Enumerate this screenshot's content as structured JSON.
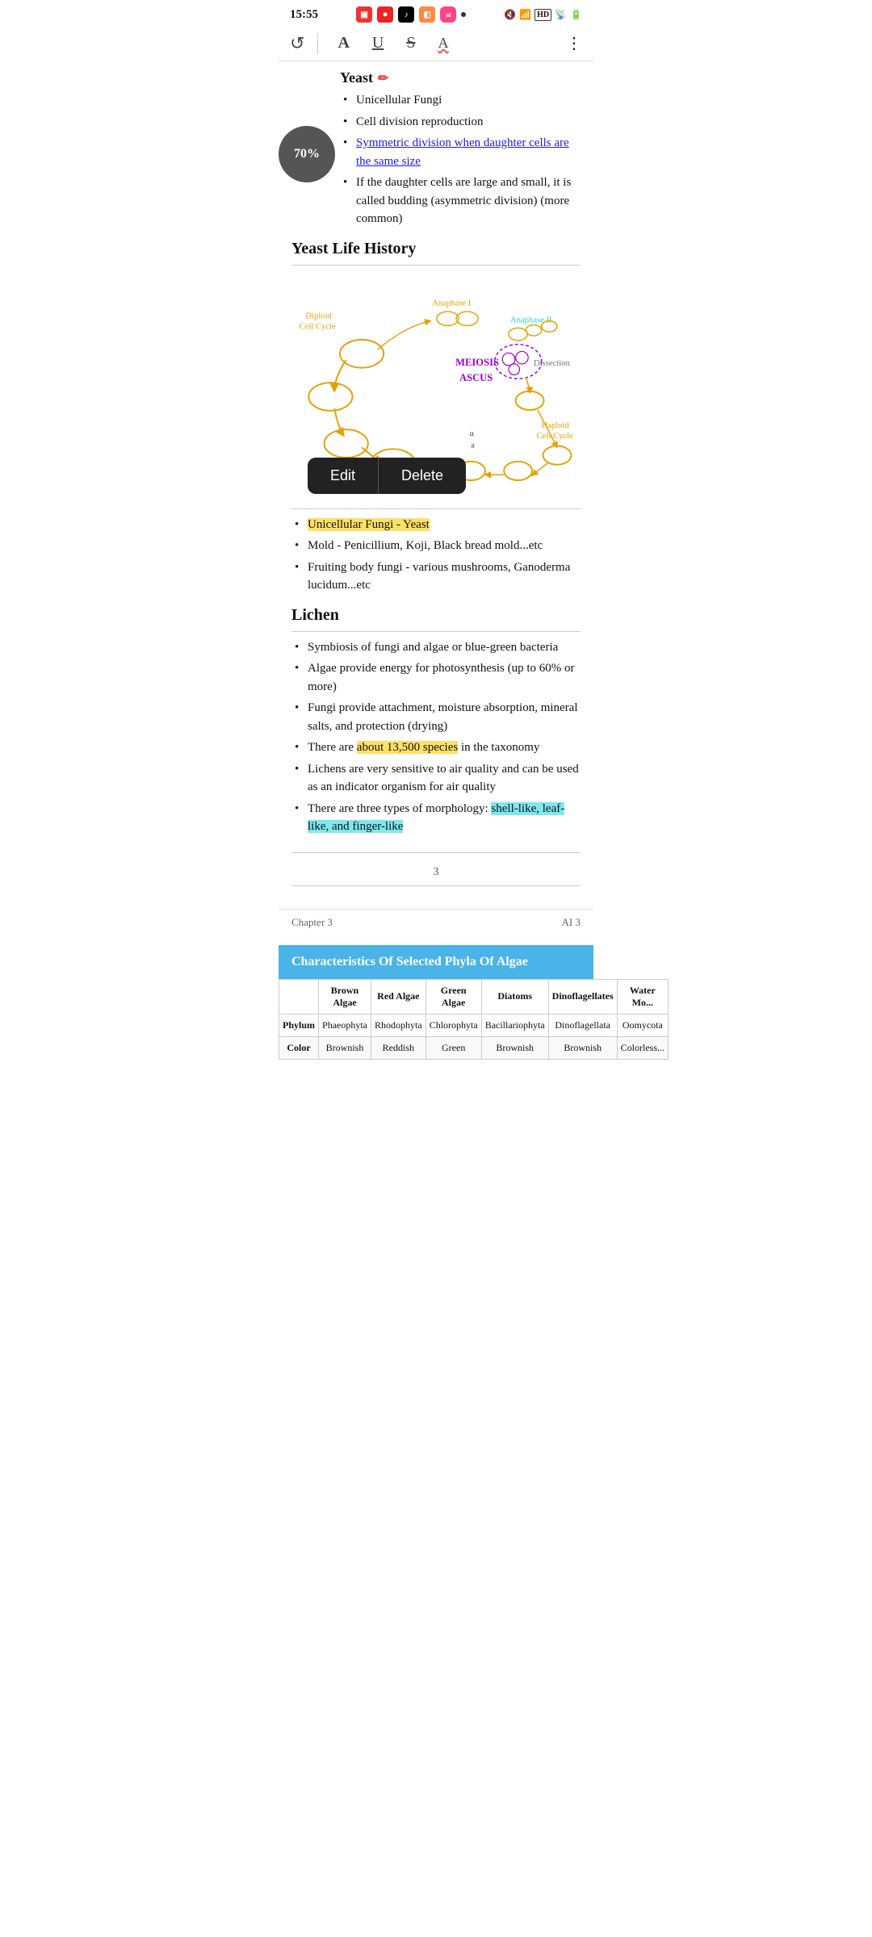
{
  "statusBar": {
    "time": "15:55",
    "dot": "●",
    "batteryIcon": "🔋"
  },
  "toolbar": {
    "undoSymbol": "↺",
    "boldLabel": "A",
    "underlineLabel": "U",
    "strikeLabel": "S",
    "waveLabel": "A",
    "moreLabel": "⋮"
  },
  "progress": {
    "value": "70%"
  },
  "content": {
    "yeastTitle": "Yeast",
    "bullets": [
      "Unicellular Fungi",
      "Cell division reproduction",
      "Symmetric division when daughter cells are the same size",
      "If the daughter cells are large and small, it is called budding (asymmetric division) (more common)"
    ],
    "yeastLifeHistoryHeading": "Yeast Life History",
    "diagramLabels": {
      "diploid": "Diploid",
      "cellCycle": "Cell Cycle",
      "anaphase1": "Anaphase I",
      "anaphase2": "Anaphase II",
      "meiosis": "MEIOSIS",
      "ascus": "ASCUS",
      "dissection": "Dissection",
      "haploid": "Haploid",
      "haploidCycle": "Cell Cycle",
      "alphaSymbol": "α",
      "aSymbol": "a"
    },
    "editLabel": "Edit",
    "deleteLabel": "Delete",
    "bullets2": [
      {
        "text": "Unicellular Fungi - Yeast",
        "highlight": "yellow"
      },
      {
        "text": "Mold - Penicillium, Koji, Black bread mold...etc",
        "highlight": "none"
      },
      {
        "text": "Fruiting body fungi - various mushrooms, Ganoderma lucidum...etc",
        "highlight": "none"
      }
    ],
    "lichenHeading": "Lichen",
    "lichenBullets": [
      {
        "text": "Symbiosis of fungi and algae or blue-green bacteria",
        "highlight": "none"
      },
      {
        "text": "Algae provide energy for photosynthesis (up to 60% or more)",
        "highlight": "none"
      },
      {
        "text": "Fungi provide attachment, moisture absorption, mineral salts, and protection (drying)",
        "highlight": "none"
      },
      {
        "text": "There are ",
        "highlight_part": "about 13,500 species",
        "text_after": " in the taxonomy",
        "highlight": "yellow"
      },
      {
        "text": "Lichens are very sensitive to air quality and can be used as an indicator organism for air quality",
        "highlight": "none"
      },
      {
        "text": "There are three types of morphology: ",
        "highlight_part": "shell-like, leaf-like, and finger-like",
        "text_after": "",
        "highlight": "cyan"
      }
    ],
    "pageNumber": "3"
  },
  "chapterFooter": {
    "left": "Chapter 3",
    "right": "AI 3"
  },
  "algaeTable": {
    "title": "Characteristics Of Selected Phyla Of Algae",
    "columns": [
      "Brown Algae",
      "Red Algae",
      "Green Algae",
      "Diatoms",
      "Dinoflagellates",
      "Water Mo..."
    ],
    "rows": [
      {
        "label": "Phylum",
        "values": [
          "Phaeophyta",
          "Rhodophyta",
          "Chlorophyta",
          "Bacillariophyta",
          "Dinoflagellata",
          "Oomycota"
        ]
      },
      {
        "label": "Color",
        "values": [
          "Brownish",
          "Reddish",
          "Green",
          "Brownish",
          "Brownish",
          "Colorless..."
        ]
      }
    ]
  }
}
